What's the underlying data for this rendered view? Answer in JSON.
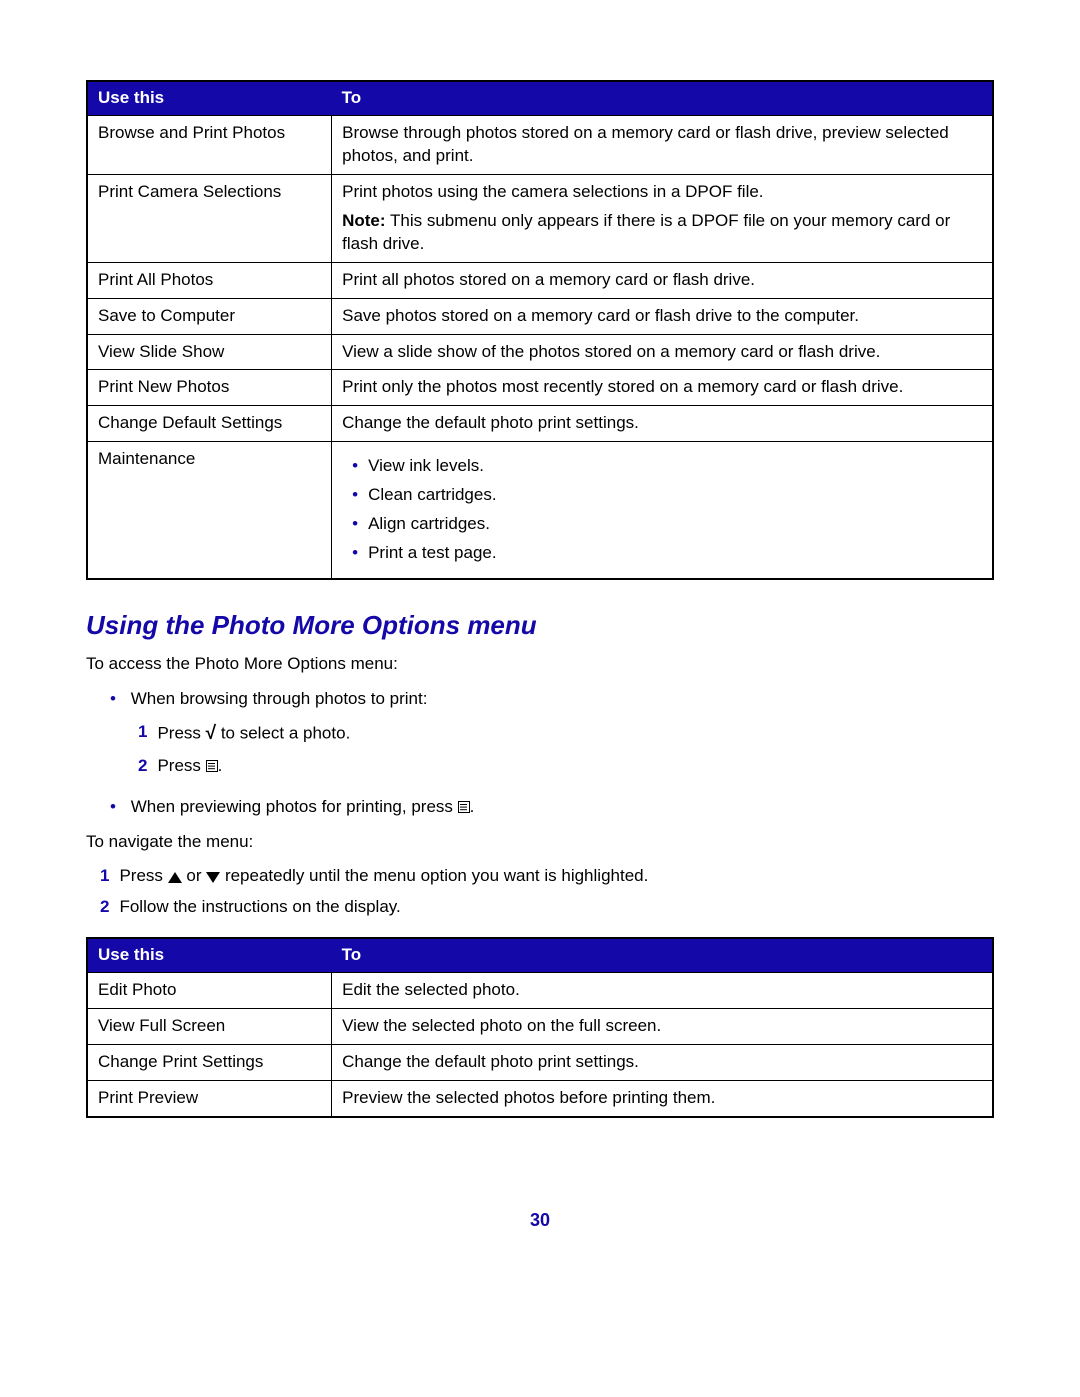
{
  "table1": {
    "header": {
      "col1": "Use this",
      "col2": "To"
    },
    "rows": {
      "r0": {
        "name": "Browse and Print Photos",
        "desc": "Browse through photos stored on a memory card or flash drive, preview selected photos, and print."
      },
      "r1": {
        "name": "Print Camera Selections",
        "desc_line1": "Print photos using the camera selections in a DPOF file.",
        "note_label": "Note:",
        "note_text": " This submenu only appears if there is a DPOF file on your memory card or flash drive."
      },
      "r2": {
        "name": "Print All Photos",
        "desc": "Print all photos stored on a memory card or flash drive."
      },
      "r3": {
        "name": "Save to Computer",
        "desc": "Save photos stored on a memory card or flash drive to the computer."
      },
      "r4": {
        "name": "View Slide Show",
        "desc": "View a slide show of the photos stored on a memory card or flash drive."
      },
      "r5": {
        "name": "Print New Photos",
        "desc": "Print only the photos most recently stored on a memory card or flash drive."
      },
      "r6": {
        "name": "Change Default Settings",
        "desc": "Change the default photo print settings."
      },
      "r7": {
        "name": "Maintenance",
        "bullets": {
          "b0": "View ink levels.",
          "b1": "Clean cartridges.",
          "b2": "Align cartridges.",
          "b3": "Print a test page."
        }
      }
    }
  },
  "section_heading": "Using the Photo More Options menu",
  "intro1": "To access the Photo More Options menu:",
  "access": {
    "bullet1": "When browsing through photos to print:",
    "step1_a": "Press ",
    "step1_b": " to select a photo.",
    "step2_a": "Press ",
    "step2_b": ".",
    "bullet2_a": "When previewing photos for printing, press ",
    "bullet2_b": "."
  },
  "navigate_intro": "To navigate the menu:",
  "nav": {
    "step1_a": "Press ",
    "step1_b": " or ",
    "step1_c": " repeatedly until the menu option you want is highlighted.",
    "step2": "Follow the instructions on the display."
  },
  "table2": {
    "header": {
      "col1": "Use this",
      "col2": "To"
    },
    "rows": {
      "r0": {
        "name": "Edit Photo",
        "desc": "Edit the selected photo."
      },
      "r1": {
        "name": "View Full Screen",
        "desc": "View the selected photo on the full screen."
      },
      "r2": {
        "name": "Change Print Settings",
        "desc": "Change the default photo print settings."
      },
      "r3": {
        "name": "Print Preview",
        "desc": "Preview the selected photos before printing them."
      }
    }
  },
  "page_number": "30",
  "nums": {
    "n1": "1",
    "n2": "2"
  }
}
